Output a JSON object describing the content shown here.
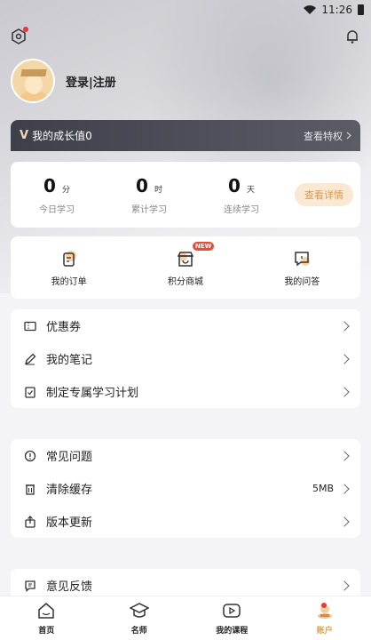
{
  "status_bar": {
    "time": "11:26"
  },
  "profile": {
    "login_text": "登录|注册"
  },
  "growth": {
    "badge": "V",
    "label": "我的成长值0",
    "link": "查看特权"
  },
  "stats": {
    "items": [
      {
        "value": "0",
        "unit": "分",
        "label": "今日学习"
      },
      {
        "value": "0",
        "unit": "时",
        "label": "累计学习"
      },
      {
        "value": "0",
        "unit": "天",
        "label": "连续学习"
      }
    ],
    "detail_button": "查看详情"
  },
  "quick_links": [
    {
      "label": "我的订单",
      "icon": "order-icon"
    },
    {
      "label": "积分商城",
      "icon": "points-mall-icon",
      "badge": "NEW"
    },
    {
      "label": "我的问答",
      "icon": "qa-icon"
    }
  ],
  "menu_group_1": [
    {
      "label": "优惠券",
      "icon": "coupon-icon"
    },
    {
      "label": "我的笔记",
      "icon": "pen-icon"
    },
    {
      "label": "制定专属学习计划",
      "icon": "plan-icon"
    }
  ],
  "menu_group_2": [
    {
      "label": "常见问题",
      "icon": "info-icon"
    },
    {
      "label": "清除缓存",
      "icon": "clear-cache-icon",
      "value": "5MB"
    },
    {
      "label": "版本更新",
      "icon": "update-icon"
    }
  ],
  "menu_group_3": [
    {
      "label": "意见反馈",
      "icon": "feedback-icon"
    }
  ],
  "tab_bar": {
    "tabs": [
      {
        "label": "首页",
        "icon": "home-icon"
      },
      {
        "label": "名师",
        "icon": "teacher-icon"
      },
      {
        "label": "我的课程",
        "icon": "my-course-icon"
      },
      {
        "label": "账户",
        "icon": "account-icon",
        "active": true
      }
    ]
  },
  "colors": {
    "accent": "#e0a04a",
    "dark_bar": "#3d3f4a",
    "badge_red": "#f0473b"
  }
}
